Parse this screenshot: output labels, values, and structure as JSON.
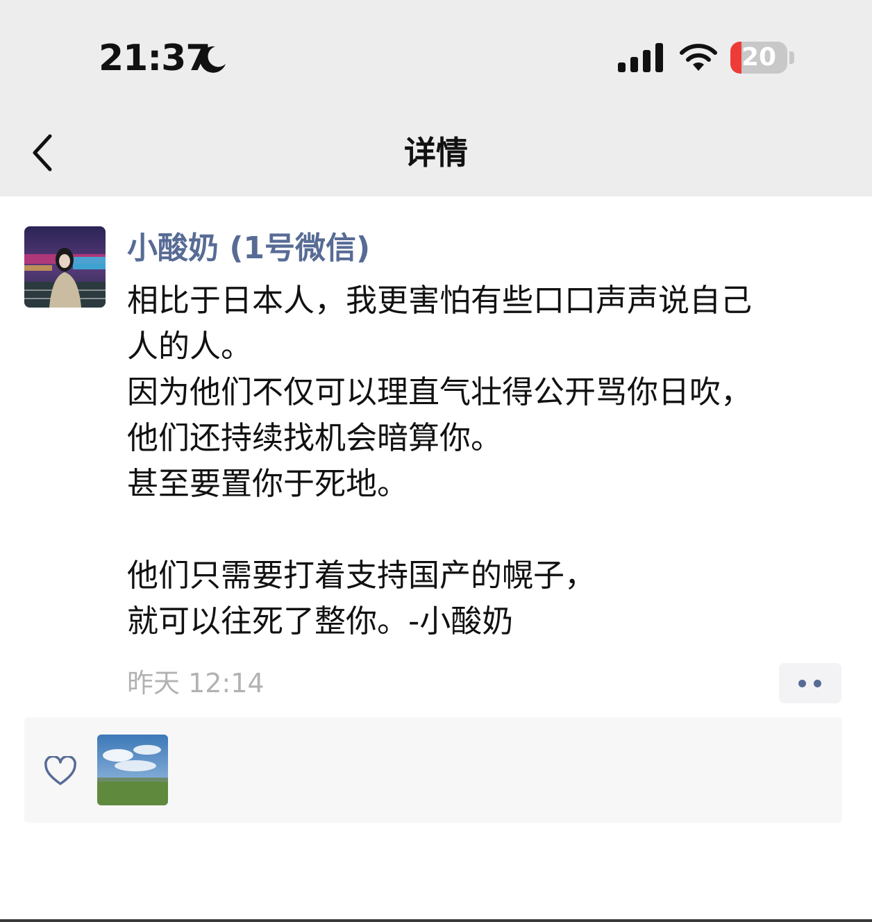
{
  "status_bar": {
    "time": "21:37",
    "battery_level": "20",
    "battery_fraction": 0.2
  },
  "nav": {
    "title": "详情"
  },
  "post": {
    "author": "小酸奶 (1号微信)",
    "content_lines": [
      "相比于日本人，我更害怕有些口口声声说自己",
      "人的人。",
      " 因为他们不仅可以理直气壮得公开骂你日吹，",
      "他们还持续找机会暗算你。",
      "甚至要置你于死地。",
      "",
      "他们只需要打着支持国产的幌子，",
      "就可以往死了整你。-小酸奶"
    ],
    "time": "昨天 12:14"
  },
  "colors": {
    "link_blue": "#576b95",
    "battery_red": "#ee3b37",
    "header_bg": "#ededed",
    "time_gray": "#b2b2b2"
  },
  "icons": [
    "moon-icon",
    "signal-icon",
    "wifi-icon",
    "battery-icon",
    "back-chevron-icon",
    "more-dots-icon",
    "heart-icon"
  ]
}
